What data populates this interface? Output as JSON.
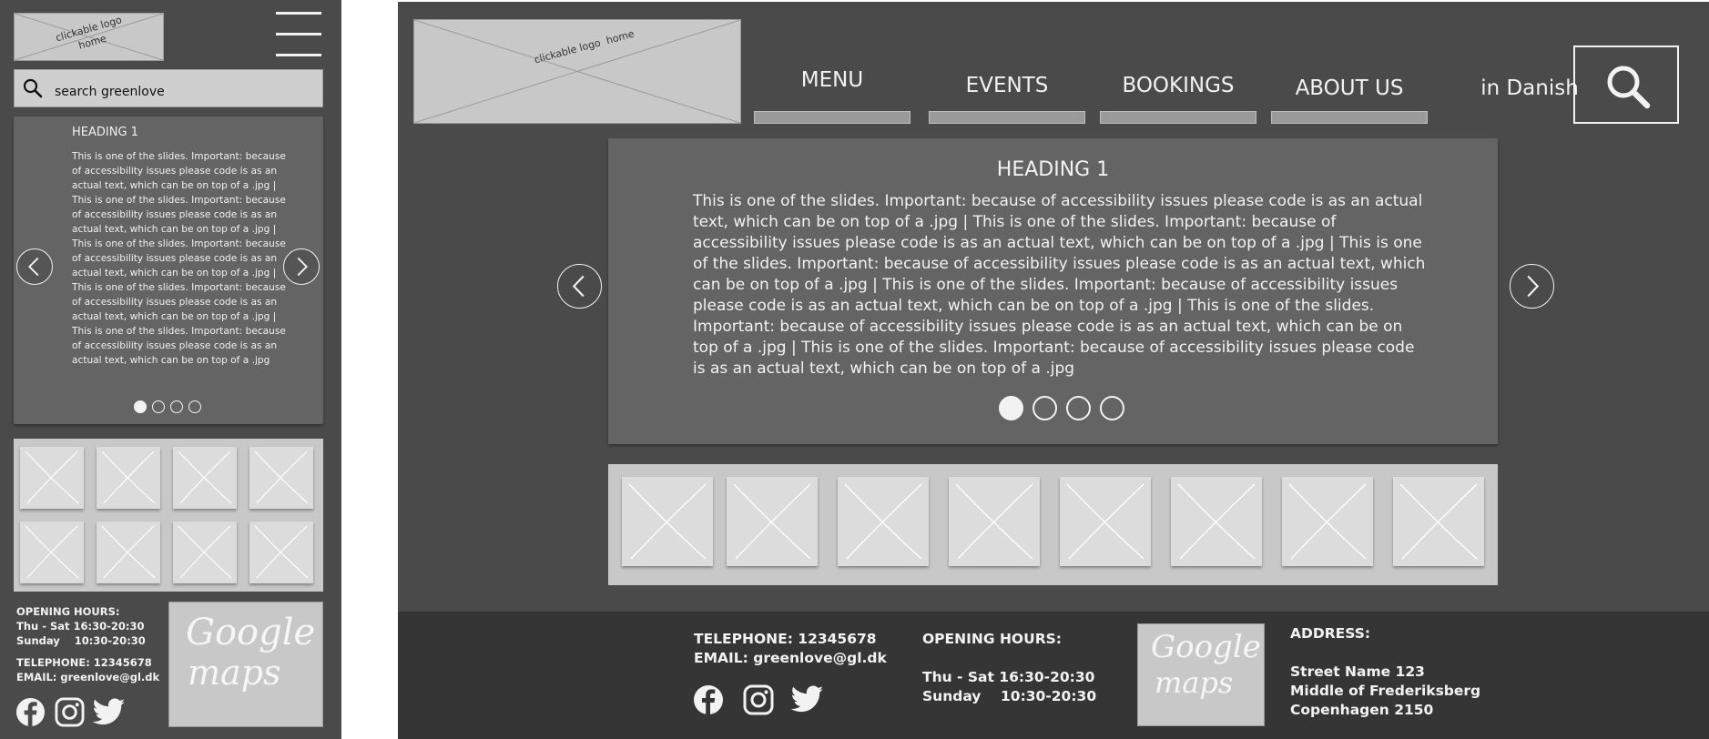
{
  "mobile": {
    "logo": {
      "line1": "clickable logo",
      "line2": "home"
    },
    "search": {
      "placeholder": "search greenlove"
    },
    "slide": {
      "heading": "HEADING 1",
      "text": "This is one of the slides. Important: because of accessibility issues please code is as an actual text, which can be on top of a .jpg  | This is one of the slides. Important: because of accessibility issues please code is as an actual text, which can be on top of a .jpg | This is one of the slides. Important: because of accessibility issues please code is as an actual text, which can be on top of a .jpg | This is one of the slides. Important: because of accessibility issues please code is as an actual text, which can be on top of a .jpg | This is one of the slides. Important: because of accessibility issues please code is as an actual text, which can be on top of a .jpg",
      "active_dot": 1,
      "dot_count": 4
    },
    "opening": {
      "title": "OPENING HOURS:",
      "line1": "Thu - Sat 16:30-20:30",
      "line2": "Sunday    10:30-20:30"
    },
    "contact": {
      "telephone": "TELEPHONE: 12345678",
      "email": "EMAIL: greenlove@gl.dk"
    },
    "maps": {
      "line1": "Google",
      "line2": "maps"
    }
  },
  "desktop": {
    "logo": {
      "line1": "clickable logo",
      "line2": "home"
    },
    "nav": {
      "menu": "MENU",
      "events": "EVENTS",
      "bookings": "BOOKINGS",
      "about": "ABOUT US",
      "language": "in Danish"
    },
    "slide": {
      "heading": "HEADING 1",
      "text": "This is one of the slides. Important: because of accessibility issues please code is as an actual text, which can be on top of a .jpg  | This is one of the slides. Important: because of accessibility issues please code is as an actual text, which can be on top of a .jpg | This is one of the slides. Important: because of accessibility issues please code is as an actual text, which can be on top of a .jpg | This is one of the slides. Important: because of accessibility issues please code is as an actual text, which can be on top of a .jpg | This is one of the slides. Important: because of accessibility issues please code is as an actual text, which can be on top of a .jpg  | This is one of the slides. Important: because of accessibility issues please code is as an actual text, which can be on top of a .jpg",
      "active_dot": 1,
      "dot_count": 4
    },
    "footer": {
      "telephone": "TELEPHONE: 12345678",
      "email": "EMAIL: greenlove@gl.dk",
      "opening_title": "OPENING HOURS:",
      "opening_line1": "Thu - Sat 16:30-20:30",
      "opening_line2": "Sunday    10:30-20:30",
      "address_title": "ADDRESS:",
      "address_line1": "Street Name 123",
      "address_line2": "Middle of Frederiksberg",
      "address_line3": "Copenhagen 2150",
      "maps": {
        "line1": "Google",
        "line2": "maps"
      }
    }
  },
  "icons": {
    "social": [
      "facebook-icon",
      "instagram-icon",
      "twitter-icon"
    ],
    "search": "search-icon",
    "menu": "hamburger-icon"
  },
  "colors": {
    "background": "#4a4a4a",
    "panel": "#646464",
    "placeholder": "#c8c8c8",
    "footer": "#353535",
    "text": "#f2f2f2"
  }
}
